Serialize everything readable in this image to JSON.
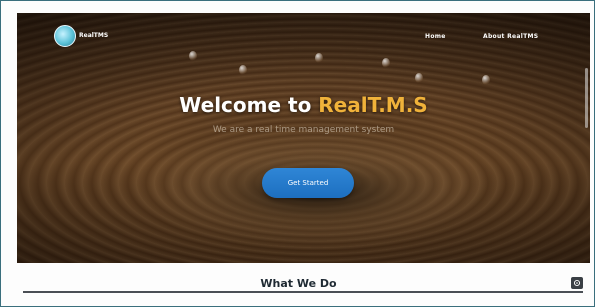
{
  "navbar": {
    "logo_text": "RealTMS",
    "links": [
      {
        "label": "Home"
      },
      {
        "label": "About RealTMS"
      }
    ]
  },
  "hero": {
    "title_prefix": "Welcome to ",
    "title_brand": "RealT.M.S",
    "subtitle": "We are a real time management system",
    "cta_label": "Get Started"
  },
  "sections": {
    "what_we_do_title": "What We Do"
  },
  "colors": {
    "brand_accent": "#f0b23a",
    "cta_blue": "#1d6fc0"
  },
  "icons": {
    "logo": "water-drop-logo-icon",
    "back_to_top": "back-to-top-icon"
  }
}
